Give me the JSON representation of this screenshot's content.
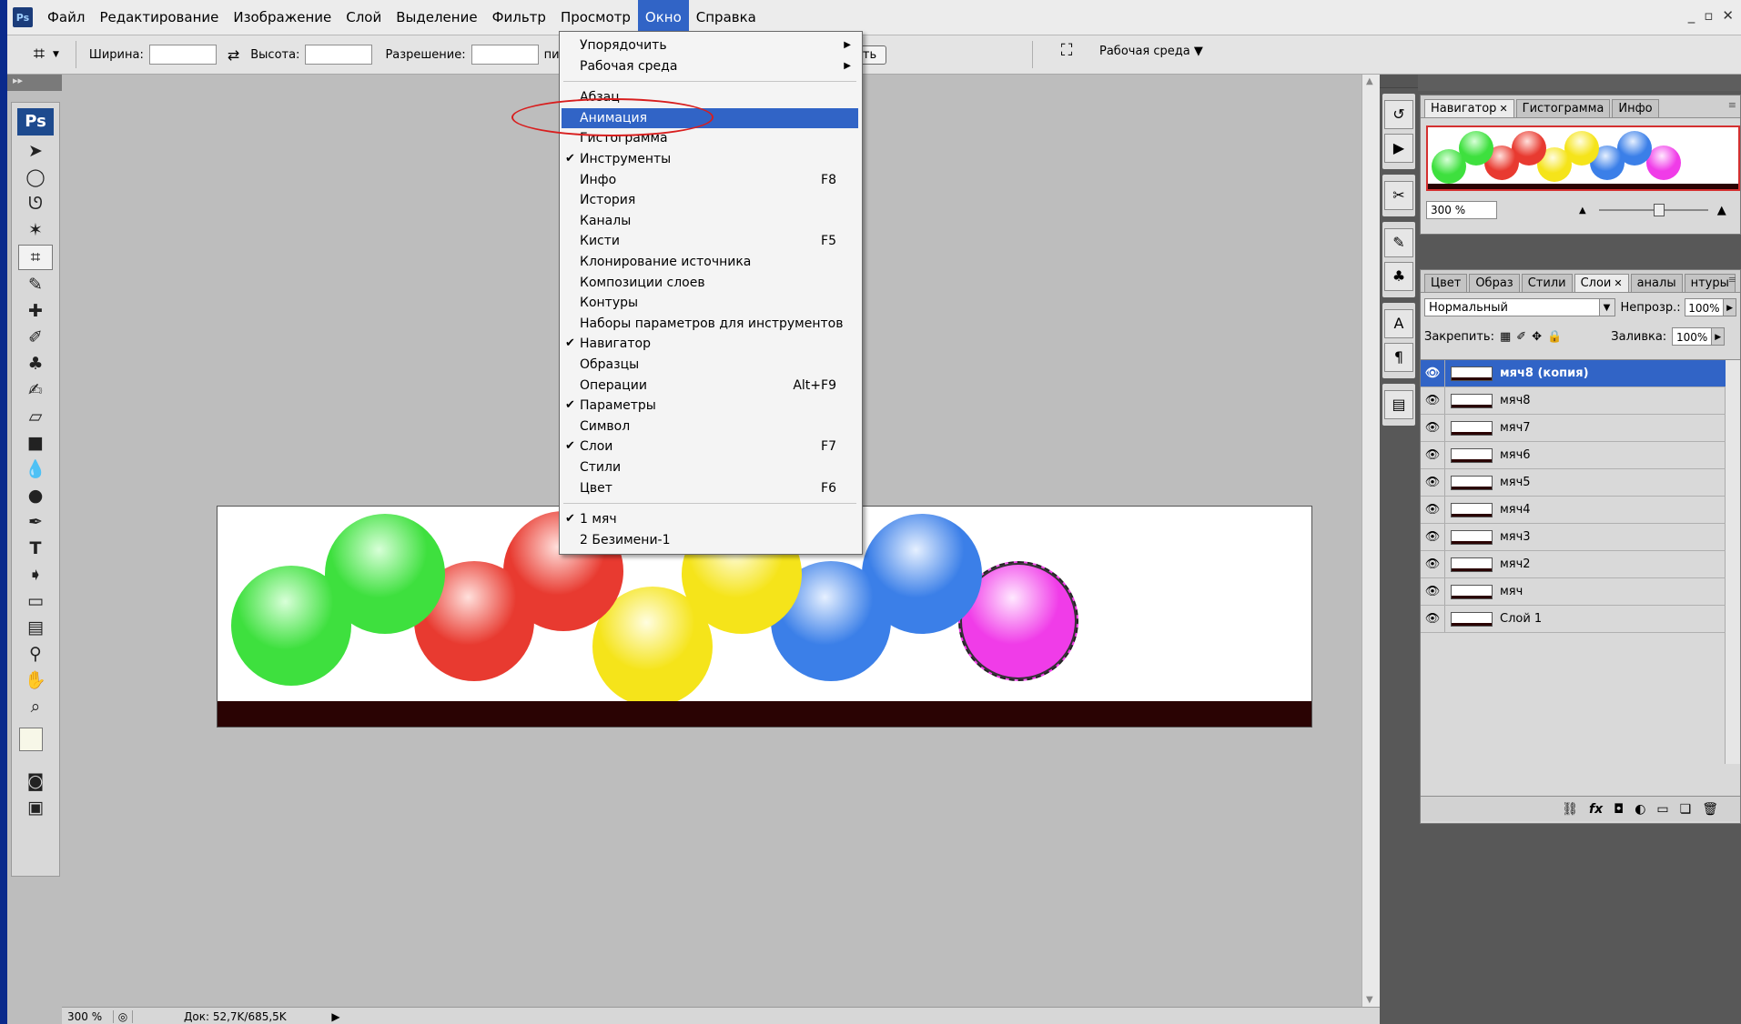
{
  "menubar": {
    "app_icon": "Ps",
    "items": [
      "Файл",
      "Редактирование",
      "Изображение",
      "Слой",
      "Выделение",
      "Фильтр",
      "Просмотр",
      "Окно",
      "Справка"
    ],
    "active_index": 7,
    "window_controls": [
      "_",
      "▫",
      "✕"
    ]
  },
  "options_bar": {
    "width_label": "Ширина:",
    "height_label": "Высота:",
    "resolution_label": "Разрешение:",
    "unit_partial": "пик",
    "button_partial": "ить",
    "workspace_label": "Рабочая среда"
  },
  "toolbox": {
    "logo": "Ps",
    "tools": [
      "move-icon",
      "lasso-oval-icon",
      "lasso-icon",
      "magic-wand-icon",
      "crop-icon",
      "slice-icon",
      "healing-icon",
      "brush-icon",
      "stamp-icon",
      "history-brush-icon",
      "eraser-icon",
      "gradient-icon",
      "blur-icon",
      "dodge-icon",
      "pen-icon",
      "type-icon",
      "path-select-icon",
      "shape-icon",
      "notes-icon",
      "eyedropper-icon",
      "hand-icon",
      "zoom-icon"
    ],
    "selected_tool": "crop-icon",
    "foreground_color": "#f7f7e8",
    "background_color": "#ff00ff"
  },
  "window_menu": {
    "items": [
      {
        "label": "Упорядочить",
        "submenu": true
      },
      {
        "label": "Рабочая среда",
        "submenu": true
      },
      {
        "sep": true
      },
      {
        "label": "Абзац"
      },
      {
        "label": "Анимация",
        "highlight": true
      },
      {
        "label": "Гистограмма"
      },
      {
        "label": "Инструменты",
        "checked": true
      },
      {
        "label": "Инфо",
        "shortcut": "F8"
      },
      {
        "label": "История"
      },
      {
        "label": "Каналы"
      },
      {
        "label": "Кисти",
        "shortcut": "F5"
      },
      {
        "label": "Клонирование источника"
      },
      {
        "label": "Композиции слоев"
      },
      {
        "label": "Контуры"
      },
      {
        "label": "Наборы параметров для инструментов"
      },
      {
        "label": "Навигатор",
        "checked": true
      },
      {
        "label": "Образцы"
      },
      {
        "label": "Операции",
        "shortcut": "Alt+F9"
      },
      {
        "label": "Параметры",
        "checked": true
      },
      {
        "label": "Символ"
      },
      {
        "label": "Слои",
        "checked": true,
        "shortcut": "F7"
      },
      {
        "label": "Стили"
      },
      {
        "label": "Цвет",
        "shortcut": "F6"
      },
      {
        "sep": true
      },
      {
        "label": "1 мяч",
        "checked": true
      },
      {
        "label": "2 Безимени-1"
      }
    ]
  },
  "canvas": {
    "background": "#ffffff",
    "floor_color": "#2a0303",
    "balls": [
      {
        "color": "#3ee03e",
        "highlight": "#d8ffd8"
      },
      {
        "color": "#3ee03e",
        "highlight": "#d8ffd8"
      },
      {
        "color": "#e83a30",
        "highlight": "#ffe0dc"
      },
      {
        "color": "#e83a30",
        "highlight": "#ffe0dc"
      },
      {
        "color": "#f5e41a",
        "highlight": "#fffde0"
      },
      {
        "color": "#f5e41a",
        "highlight": "#fffde0"
      },
      {
        "color": "#3b7fe8",
        "highlight": "#e6f0ff"
      },
      {
        "color": "#3b7fe8",
        "highlight": "#e6f0ff"
      },
      {
        "color": "#f03ce8",
        "highlight": "#ffe8ff"
      }
    ]
  },
  "status_bar": {
    "zoom": "300 %",
    "doc": "Док: 52,7K/685,5K"
  },
  "navigator_panel": {
    "tabs": [
      "Навигатор",
      "Гистограмма",
      "Инфо"
    ],
    "active_tab": 0,
    "zoom_value": "300 %"
  },
  "layers_panel": {
    "tabs": [
      "Цвет",
      "Образ",
      "Стили",
      "Слои",
      "аналы",
      "нтуры"
    ],
    "active_tab": 3,
    "blend_mode": "Нормальный",
    "opacity_label": "Непрозр.:",
    "opacity_value": "100%",
    "lock_label": "Закрепить:",
    "fill_label": "Заливка:",
    "fill_value": "100%",
    "layers": [
      {
        "name": "мяч8 (копия)",
        "active": true
      },
      {
        "name": "мяч8"
      },
      {
        "name": "мяч7"
      },
      {
        "name": "мяч6"
      },
      {
        "name": "мяч5"
      },
      {
        "name": "мяч4"
      },
      {
        "name": "мяч3"
      },
      {
        "name": "мяч2"
      },
      {
        "name": "мяч"
      },
      {
        "name": "Слой 1"
      }
    ],
    "footer_icons": [
      "link-icon",
      "fx-icon",
      "mask-icon",
      "adjustment-icon",
      "folder-icon",
      "new-layer-icon",
      "trash-icon"
    ]
  },
  "annotation": {
    "color": "#d81e1e"
  }
}
